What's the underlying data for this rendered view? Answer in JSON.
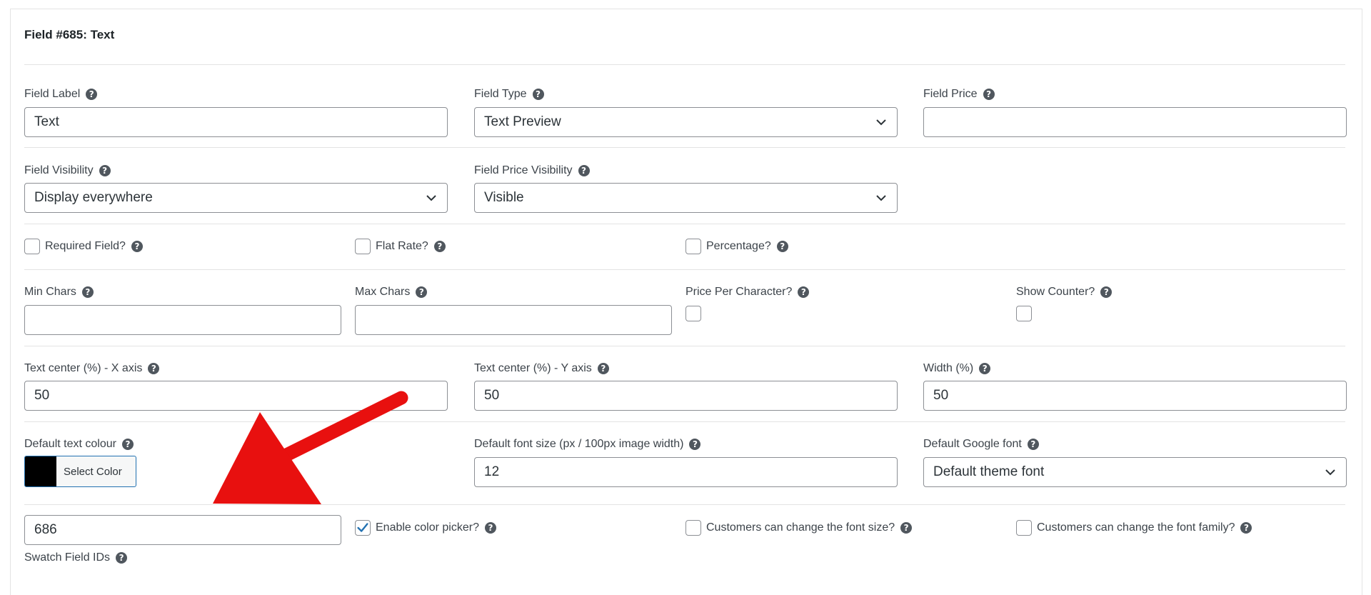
{
  "header": {
    "title": "Field #685: Text"
  },
  "row1": {
    "field_label": {
      "label": "Field Label",
      "value": "Text"
    },
    "field_type": {
      "label": "Field Type",
      "value": "Text Preview"
    },
    "field_price": {
      "label": "Field Price",
      "value": ""
    }
  },
  "row2": {
    "field_visibility": {
      "label": "Field Visibility",
      "value": "Display everywhere"
    },
    "field_price_visibility": {
      "label": "Field Price Visibility",
      "value": "Visible"
    }
  },
  "row3": {
    "required": {
      "label": "Required Field?",
      "checked": false
    },
    "flat_rate": {
      "label": "Flat Rate?",
      "checked": false
    },
    "percentage": {
      "label": "Percentage?",
      "checked": false
    }
  },
  "row4": {
    "min_chars": {
      "label": "Min Chars",
      "value": ""
    },
    "max_chars": {
      "label": "Max Chars",
      "value": ""
    },
    "price_per_char": {
      "label": "Price Per Character?",
      "checked": false
    },
    "show_counter": {
      "label": "Show Counter?",
      "checked": false
    }
  },
  "row5": {
    "center_x": {
      "label": "Text center (%) - X axis",
      "value": "50"
    },
    "center_y": {
      "label": "Text center (%) - Y axis",
      "value": "50"
    },
    "width": {
      "label": "Width (%)",
      "value": "50"
    }
  },
  "row6": {
    "text_colour": {
      "label": "Default text colour",
      "button": "Select Color",
      "color": "#000000"
    },
    "font_size": {
      "label": "Default font size (px / 100px image width)",
      "value": "12"
    },
    "google_font": {
      "label": "Default Google font",
      "value": "Default theme font"
    }
  },
  "row7": {
    "swatch_ids": {
      "label": "Swatch Field IDs",
      "value": "686"
    },
    "enable_color_picker": {
      "label": "Enable color picker?",
      "checked": true
    },
    "change_font_size": {
      "label": "Customers can change the font size?",
      "checked": false
    },
    "change_font_family": {
      "label": "Customers can change the font family?",
      "checked": false
    }
  },
  "icons": {
    "help": "help-icon",
    "dropdown": "chevron-down-icon",
    "check": "checkmark-icon",
    "annotation": "red-arrow"
  },
  "colors": {
    "accent": "#2271b1",
    "arrow": "#e8100f",
    "border": "#8c8f94"
  }
}
